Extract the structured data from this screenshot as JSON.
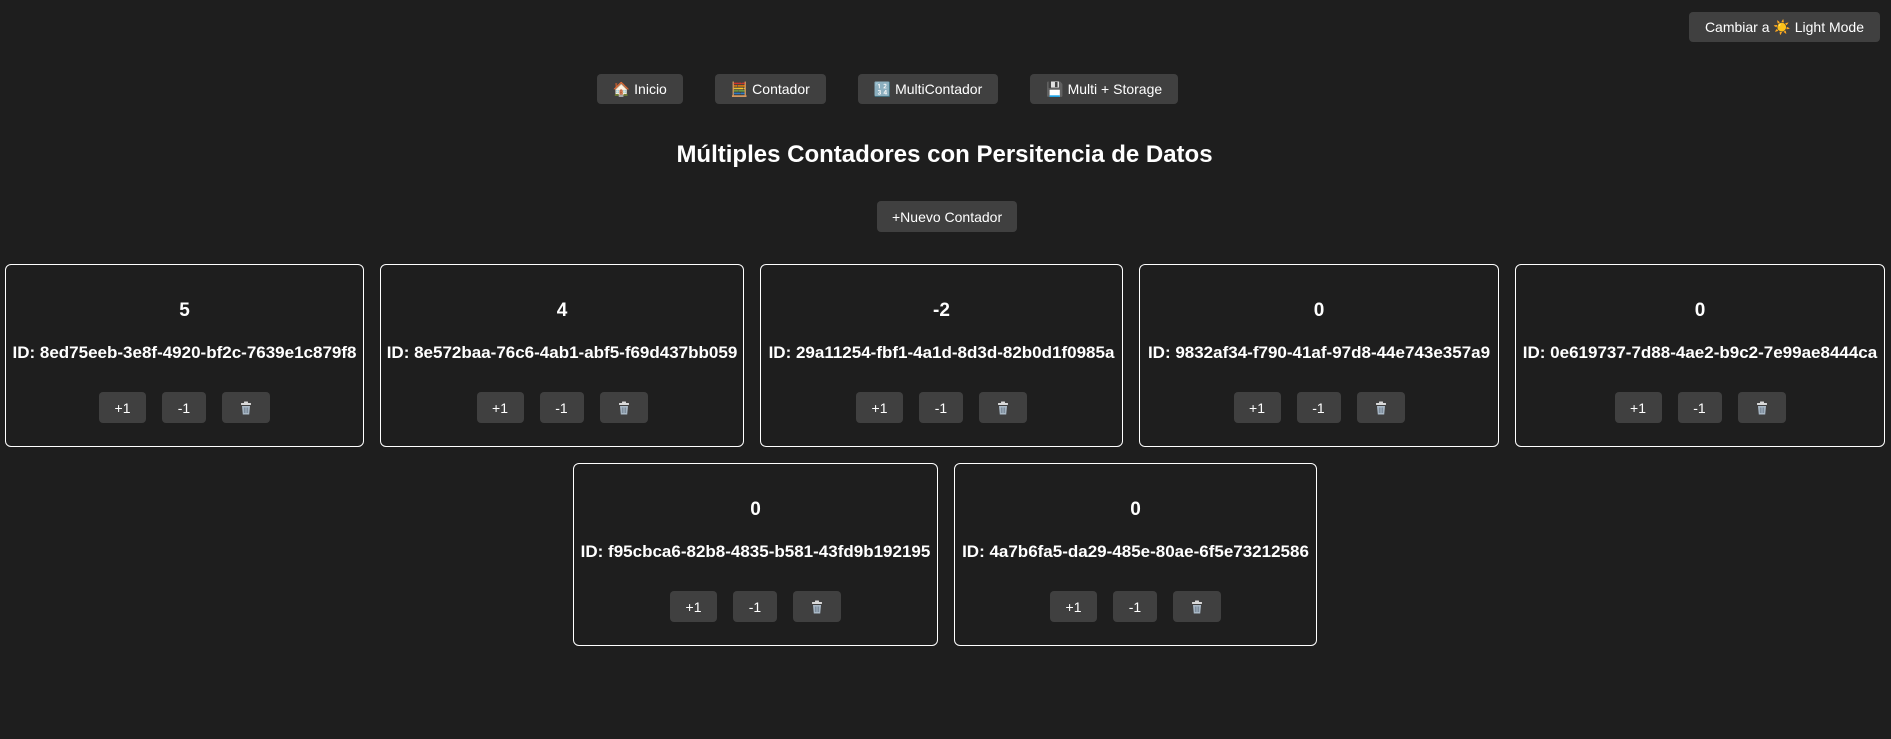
{
  "theme_toggle": {
    "label": "Cambiar a ☀️ Light Mode"
  },
  "nav": {
    "items": [
      {
        "label": "🏠 Inicio"
      },
      {
        "label": "🧮 Contador"
      },
      {
        "label": "🔢 MultiContador"
      },
      {
        "label": "💾 Multi + Storage"
      }
    ]
  },
  "page": {
    "title": "Múltiples Contadores con Persitencia de Datos",
    "new_counter_label": "+Nuevo Contador"
  },
  "card_actions": {
    "increment": "+1",
    "decrement": "-1",
    "delete_icon": "trash-icon"
  },
  "counters": [
    {
      "value": "5",
      "id": "ID: 8ed75eeb-3e8f-4920-bf2c-7639e1c879f8"
    },
    {
      "value": "4",
      "id": "ID: 8e572baa-76c6-4ab1-abf5-f69d437bb059"
    },
    {
      "value": "-2",
      "id": "ID: 29a11254-fbf1-4a1d-8d3d-82b0d1f0985a"
    },
    {
      "value": "0",
      "id": "ID: 9832af34-f790-41af-97d8-44e743e357a9"
    },
    {
      "value": "0",
      "id": "ID: 0e619737-7d88-4ae2-b9c2-7e99ae8444ca"
    },
    {
      "value": "0",
      "id": "ID: f95cbca6-82b8-4835-b581-43fd9b192195"
    },
    {
      "value": "0",
      "id": "ID: 4a7b6fa5-da29-485e-80ae-6f5e73212586"
    }
  ],
  "colors": {
    "background": "#1e1e1e",
    "button": "#404040",
    "text": "#ffffff",
    "card_border": "#ffffff"
  }
}
